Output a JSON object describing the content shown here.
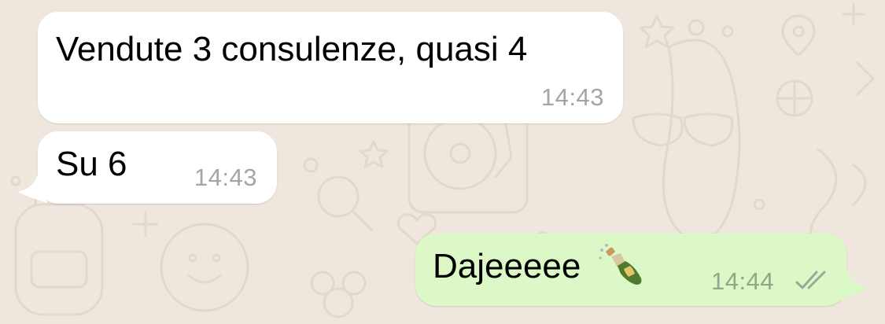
{
  "chat": {
    "messages": [
      {
        "direction": "incoming",
        "text": "Vendute 3 consulenze, quasi 4",
        "time": "14:43"
      },
      {
        "direction": "incoming",
        "text": "Su 6",
        "time": "14:43"
      },
      {
        "direction": "outgoing",
        "text": "Dajeeeee",
        "emoji": "champagne-bottle-icon",
        "time": "14:44",
        "status": "read-double-check-icon"
      }
    ]
  },
  "colors": {
    "wallpaper": "#efe7dd",
    "incoming_bubble": "#ffffff",
    "outgoing_bubble": "#dcf8c6",
    "timestamp": "#a5a5a5",
    "ticks": "#9aa89a"
  }
}
